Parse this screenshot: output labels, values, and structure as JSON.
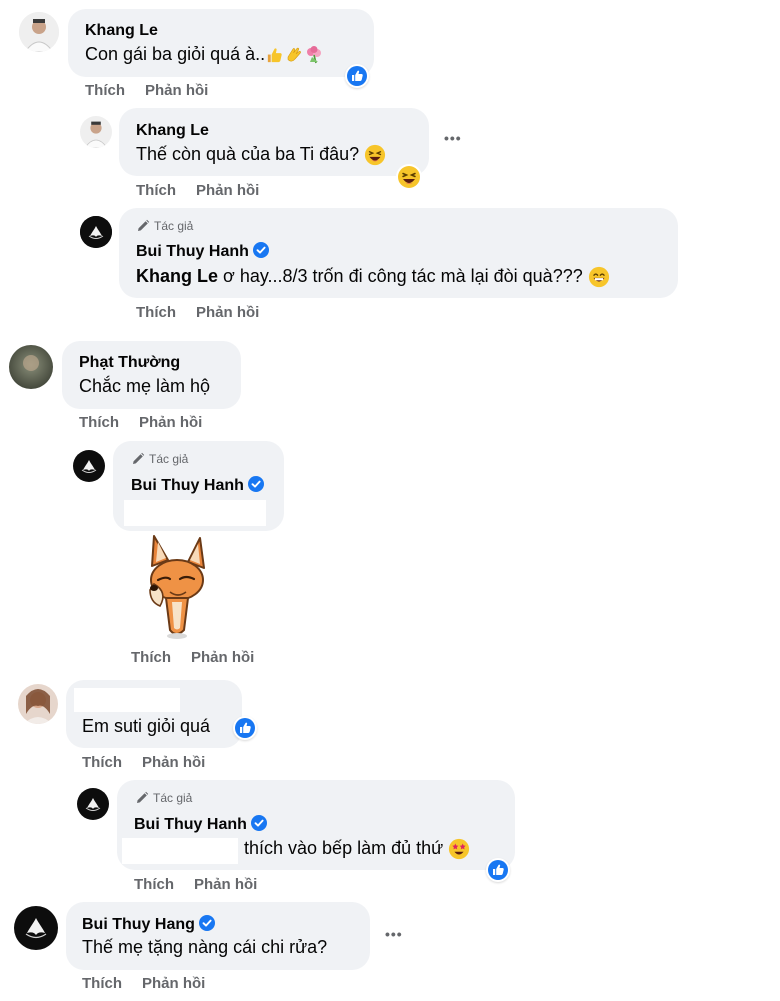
{
  "comments": [
    {
      "author": "Khang Le",
      "text": "Con gái ba giỏi quá à..",
      "actions": [
        "Thích",
        "Phản hồi"
      ]
    },
    {
      "author": "Khang Le",
      "text": "Thế còn quà của ba Ti đâu?",
      "actions": [
        "Thích",
        "Phản hồi"
      ],
      "more": "•••"
    },
    {
      "author_tag": "Tác giả",
      "author": "Bui Thuy Hanh",
      "mention": "Khang Le",
      "text": "ơ hay...8/3 trốn đi công tác mà lại đòi quà???",
      "actions": [
        "Thích",
        "Phản hồi"
      ]
    },
    {
      "author": "Phạt Thường",
      "text": "Chắc mẹ làm hộ",
      "actions": [
        "Thích",
        "Phản hồi"
      ]
    },
    {
      "author_tag": "Tác giả",
      "author": "Bui Thuy Hanh",
      "actions": [
        "Thích",
        "Phản hồi"
      ]
    },
    {
      "text": "Em suti giỏi quá",
      "actions": [
        "Thích",
        "Phản hồi"
      ]
    },
    {
      "author_tag": "Tác giả",
      "author": "Bui Thuy Hanh",
      "text": "thích vào bếp làm đủ thứ",
      "actions": [
        "Thích",
        "Phản hồi"
      ]
    },
    {
      "author": "Bui Thuy Hang",
      "text": "Thế mẹ tặng nàng cái chi rửa?",
      "actions": [
        "Thích",
        "Phản hồi"
      ],
      "more": "•••"
    }
  ],
  "colors": {
    "bubble": "#f0f2f5",
    "action_text": "#65676b",
    "verified": "#1877f2",
    "like": "#1877f2"
  },
  "icons": [
    "verified-badge-icon",
    "like-reaction-icon",
    "pencil-icon",
    "more-options-icon",
    "thumbs-up-emoji",
    "clapping-emoji",
    "flower-emoji",
    "laughing-emoji",
    "grinning-emoji",
    "star-struck-emoji",
    "dog-sticker"
  ]
}
